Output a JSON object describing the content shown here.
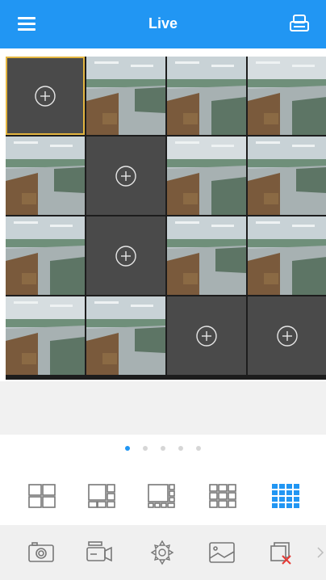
{
  "header": {
    "title": "Live",
    "menu_icon": "hamburger-menu-icon",
    "right_icon": "printer-icon"
  },
  "colors": {
    "accent": "#2196f3",
    "empty_cell": "#4a4a4a",
    "selected_border": "#e3b540",
    "divider": "#1d1d1d",
    "action_bar_bg": "#f0f0f0"
  },
  "grid": {
    "rows": 4,
    "cols": 4,
    "selected_cell": 0,
    "cells": [
      {
        "state": "empty"
      },
      {
        "state": "feed"
      },
      {
        "state": "feed"
      },
      {
        "state": "feed"
      },
      {
        "state": "feed"
      },
      {
        "state": "empty"
      },
      {
        "state": "feed"
      },
      {
        "state": "feed"
      },
      {
        "state": "feed"
      },
      {
        "state": "empty"
      },
      {
        "state": "feed"
      },
      {
        "state": "feed"
      },
      {
        "state": "feed"
      },
      {
        "state": "feed"
      },
      {
        "state": "empty"
      },
      {
        "state": "empty"
      }
    ],
    "add_icon": "add-circle-icon"
  },
  "pager": {
    "page_count": 5,
    "current_page": 1
  },
  "layout_options": [
    {
      "name": "layout-4-split",
      "icon": "layout-2x2-icon",
      "active": false
    },
    {
      "name": "layout-6-split",
      "icon": "layout-6-icon",
      "active": false
    },
    {
      "name": "layout-8-split",
      "icon": "layout-8-icon",
      "active": false
    },
    {
      "name": "layout-9-split",
      "icon": "layout-3x3-icon",
      "active": false
    },
    {
      "name": "layout-16-split",
      "icon": "layout-4x4-icon",
      "active": true
    }
  ],
  "actions": [
    {
      "name": "snapshot",
      "icon": "camera-icon"
    },
    {
      "name": "record",
      "icon": "video-record-icon"
    },
    {
      "name": "ptz",
      "icon": "ptz-control-icon"
    },
    {
      "name": "image",
      "icon": "image-icon"
    },
    {
      "name": "close-all",
      "icon": "close-all-windows-icon"
    }
  ],
  "more_icon": "chevron-right-icon"
}
